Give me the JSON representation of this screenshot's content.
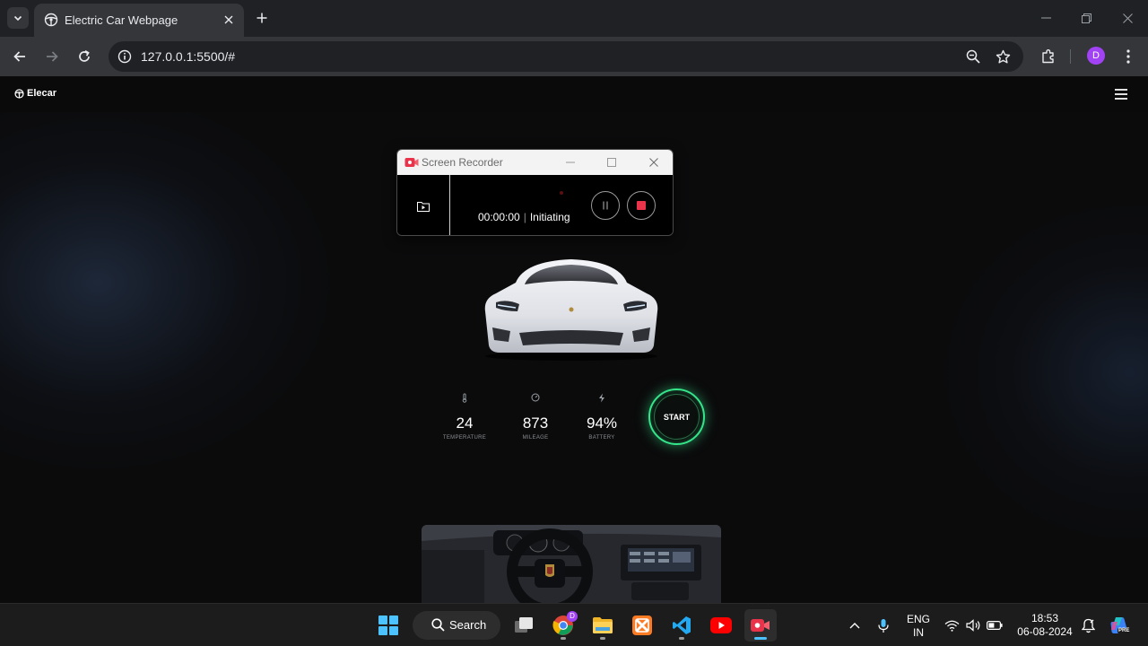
{
  "browser": {
    "tab": {
      "title": "Electric Car Webpage"
    },
    "address": {
      "url": "127.0.0.1:5500/#"
    },
    "profile_initial": "D"
  },
  "site": {
    "logo_text": "Elecar",
    "stats": [
      {
        "icon": "thermometer-icon",
        "value": "24",
        "label": "TEMPERATURE"
      },
      {
        "icon": "speedometer-icon",
        "value": "873",
        "label": "MILEAGE"
      },
      {
        "icon": "lightning-icon",
        "value": "94%",
        "label": "BATTERY"
      }
    ],
    "start_label": "START"
  },
  "recorder": {
    "title": "Screen Recorder",
    "time": "00:00:00",
    "status": "Initiating"
  },
  "taskbar": {
    "search_label": "Search",
    "chrome_badge": "D",
    "language": {
      "line1": "ENG",
      "line2": "IN"
    },
    "clock": {
      "time": "18:53",
      "date": "06-08-2024"
    },
    "copilot_badge": "PRE"
  },
  "colors": {
    "accent_green": "#35e58a",
    "stop_red": "#e8334a",
    "profile_purple": "#a142f4",
    "windows_blue": "#4cc2ff"
  }
}
